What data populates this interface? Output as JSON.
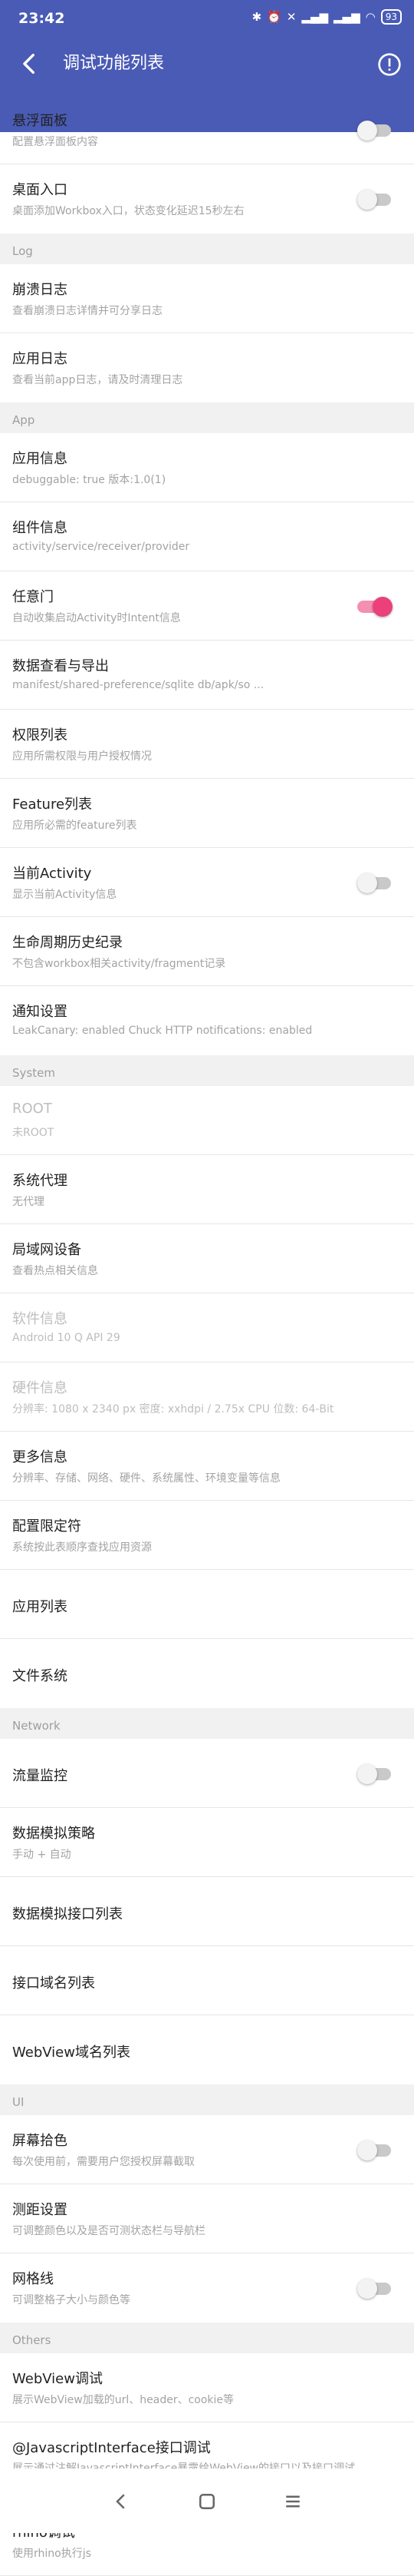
{
  "status_bar": {
    "time": "23:42",
    "battery": "93"
  },
  "app_bar": {
    "title": "调试功能列表"
  },
  "sections": [
    {
      "header": "",
      "items": [
        {
          "title": "悬浮面板",
          "sub": "配置悬浮面板内容",
          "switch": "off"
        },
        {
          "title": "桌面入口",
          "sub": "桌面添加Workbox入口，状态变化延迟15秒左右",
          "switch": "off"
        }
      ]
    },
    {
      "header": "Log",
      "items": [
        {
          "title": "崩溃日志",
          "sub": "查看崩溃日志详情并可分享日志"
        },
        {
          "title": "应用日志",
          "sub": "查看当前app日志，请及时清理日志"
        }
      ]
    },
    {
      "header": "App",
      "items": [
        {
          "title": "应用信息",
          "sub": "debuggable: true   版本:1.0(1)"
        },
        {
          "title": "组件信息",
          "sub": "activity/service/receiver/provider"
        },
        {
          "title": "任意门",
          "sub": "自动收集启动Activity时Intent信息",
          "switch": "on"
        },
        {
          "title": "数据查看与导出",
          "sub": "manifest/shared-preference/sqlite db/apk/so ..."
        },
        {
          "title": "权限列表",
          "sub": "应用所需权限与用户授权情况"
        },
        {
          "title": "Feature列表",
          "sub": "应用所必需的feature列表"
        },
        {
          "title": "当前Activity",
          "sub": "显示当前Activity信息",
          "switch": "off"
        },
        {
          "title": "生命周期历史纪录",
          "sub": "不包含workbox相关activity/fragment记录"
        },
        {
          "title": "通知设置",
          "sub": "LeakCanary: enabled  Chuck HTTP notifications: enabled"
        }
      ]
    },
    {
      "header": "System",
      "items": [
        {
          "title": "ROOT",
          "sub": "未ROOT",
          "dim": true
        },
        {
          "title": "系统代理",
          "sub": "无代理"
        },
        {
          "title": "局域网设备",
          "sub": "查看热点相关信息"
        },
        {
          "title": "软件信息",
          "sub": "Android 10    Q    API 29",
          "dim": true
        },
        {
          "title": "硬件信息",
          "sub": "分辨率: 1080 x 2340 px    密度: xxhdpi / 2.75x   CPU 位数: 64-Bit",
          "dim": true
        },
        {
          "title": "更多信息",
          "sub": "分辨率、存储、网络、硬件、系统属性、环境变量等信息"
        },
        {
          "title": "配置限定符",
          "sub": "系统按此表顺序查找应用资源"
        },
        {
          "title": "应用列表",
          "sub": ""
        },
        {
          "title": "文件系统",
          "sub": ""
        }
      ]
    },
    {
      "header": "Network",
      "items": [
        {
          "title": "流量监控",
          "sub": "",
          "switch": "off"
        },
        {
          "title": "数据模拟策略",
          "sub": "手动 + 自动"
        },
        {
          "title": "数据模拟接口列表",
          "sub": ""
        },
        {
          "title": "接口域名列表",
          "sub": ""
        },
        {
          "title": "WebView域名列表",
          "sub": ""
        }
      ]
    },
    {
      "header": "UI",
      "items": [
        {
          "title": "屏幕拾色",
          "sub": "每次使用前，需要用户您授权屏幕截取",
          "switch": "off"
        },
        {
          "title": "测距设置",
          "sub": "可调整颜色以及是否可测状态栏与导航栏"
        },
        {
          "title": "网格线",
          "sub": "可调整格子大小与颜色等",
          "switch": "off"
        }
      ]
    },
    {
      "header": "Others",
      "items": [
        {
          "title": "WebView调试",
          "sub": "展示WebView加载的url、header、cookie等"
        },
        {
          "title": "@JavascriptInterface接口调试",
          "sub": "展示通过注解JavascriptInterface暴露给WebView的接口以及接口调试",
          "tall": true
        },
        {
          "title": "rhino调试",
          "sub": "使用rhino执行js"
        }
      ]
    }
  ],
  "icons": {
    "back": "arrow-back-icon",
    "info": "info-circle-icon",
    "nav": [
      "nav-back-icon",
      "nav-home-icon",
      "nav-recents-icon"
    ]
  },
  "colors": {
    "primary": "#4a5bb6",
    "accent": "#ec407a",
    "section_bg": "#f1f1f1"
  }
}
